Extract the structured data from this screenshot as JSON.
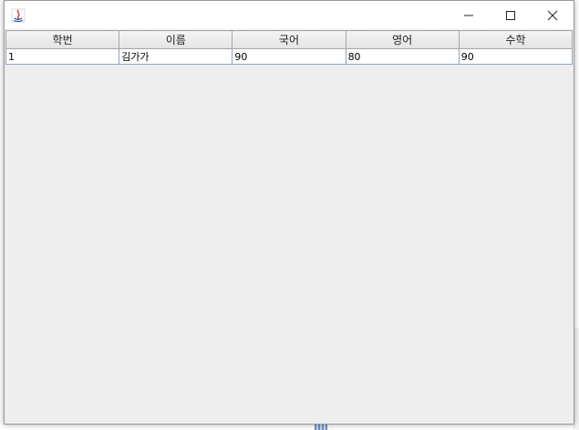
{
  "window": {
    "title": "",
    "controls": {
      "minimize_icon": "minimize-icon",
      "maximize_icon": "maximize-icon",
      "close_icon": "close-icon"
    }
  },
  "table": {
    "columns": [
      "학번",
      "이름",
      "국어",
      "영어",
      "수학"
    ],
    "rows": [
      [
        "1",
        "김가가",
        "90",
        "80",
        "90"
      ]
    ]
  },
  "colors": {
    "content_bg": "#eeeeee",
    "header_bg": "#e9e9e9",
    "grid_line": "#8fa3bf"
  }
}
